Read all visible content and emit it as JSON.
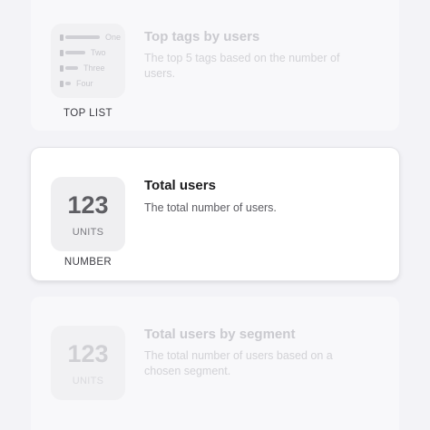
{
  "cards": [
    {
      "title": "Top tags by users",
      "description": "The top 5 tags based on the number of users.",
      "type_label": "TOP LIST",
      "list_items": [
        "One",
        "Two",
        "Three",
        "Four"
      ]
    },
    {
      "title": "Total users",
      "description": "The total number of users.",
      "type_label": "NUMBER",
      "number": "123",
      "units": "UNITS"
    },
    {
      "title": "Total users by segment",
      "description": "The total number of users based on a chosen segment.",
      "number": "123",
      "units": "UNITS"
    }
  ]
}
